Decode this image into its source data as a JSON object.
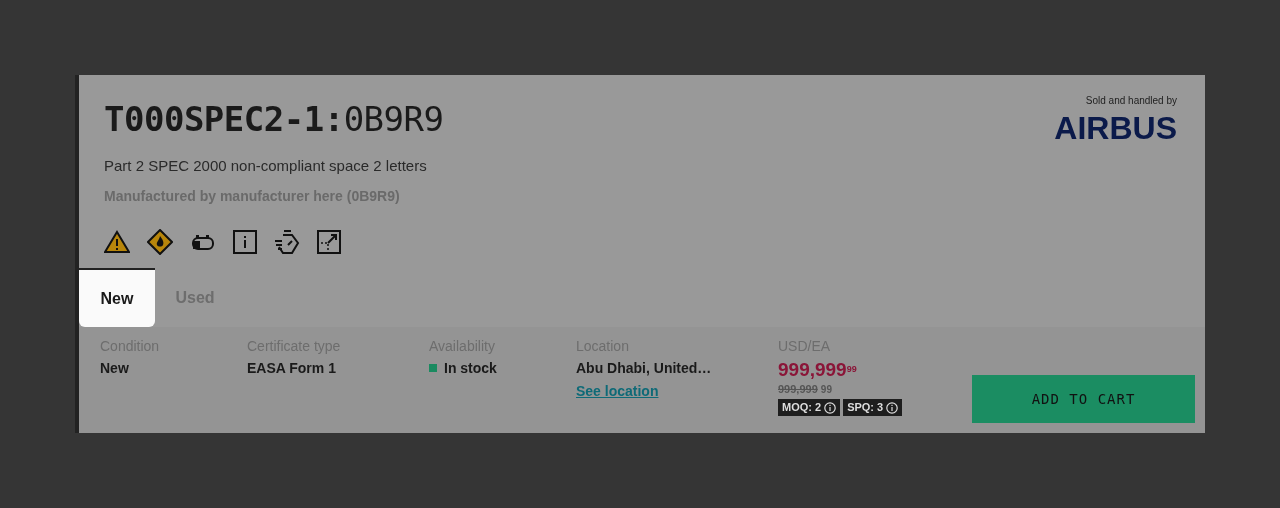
{
  "part": {
    "number": "T000SPEC2-1:",
    "cage": "0B9R9",
    "description": "Part 2 SPEC 2000 non-compliant space 2 letters",
    "manufacturer": "Manufactured by manufacturer here (0B9R9)"
  },
  "seller": {
    "caption": "Sold and handled by",
    "logo": "AIRBUS"
  },
  "hazard_icons": [
    {
      "kind": "warning"
    },
    {
      "kind": "flammable"
    },
    {
      "kind": "battery"
    },
    {
      "kind": "info"
    },
    {
      "kind": "timer"
    },
    {
      "kind": "oversize"
    }
  ],
  "tabs": [
    {
      "label": "New",
      "selected": true
    },
    {
      "label": "Used",
      "selected": false
    }
  ],
  "details": [
    {
      "label": "Condition",
      "value": "New"
    },
    {
      "label": "Certificate type",
      "value": "EASA Form 1"
    },
    {
      "label": "Availability",
      "value": "In stock",
      "color": "#1a8a60"
    },
    {
      "label": "Location",
      "value": "Abu Dhabi, United…",
      "link": "See location"
    }
  ],
  "price": {
    "unit": "USD/EA",
    "amount": "999,999",
    "cents": "99",
    "old_amount": "999,999",
    "old_cents": "99",
    "badges": [
      "MOQ: 2",
      "SPQ: 3"
    ]
  },
  "add_to_cart": "ADD TO CART"
}
